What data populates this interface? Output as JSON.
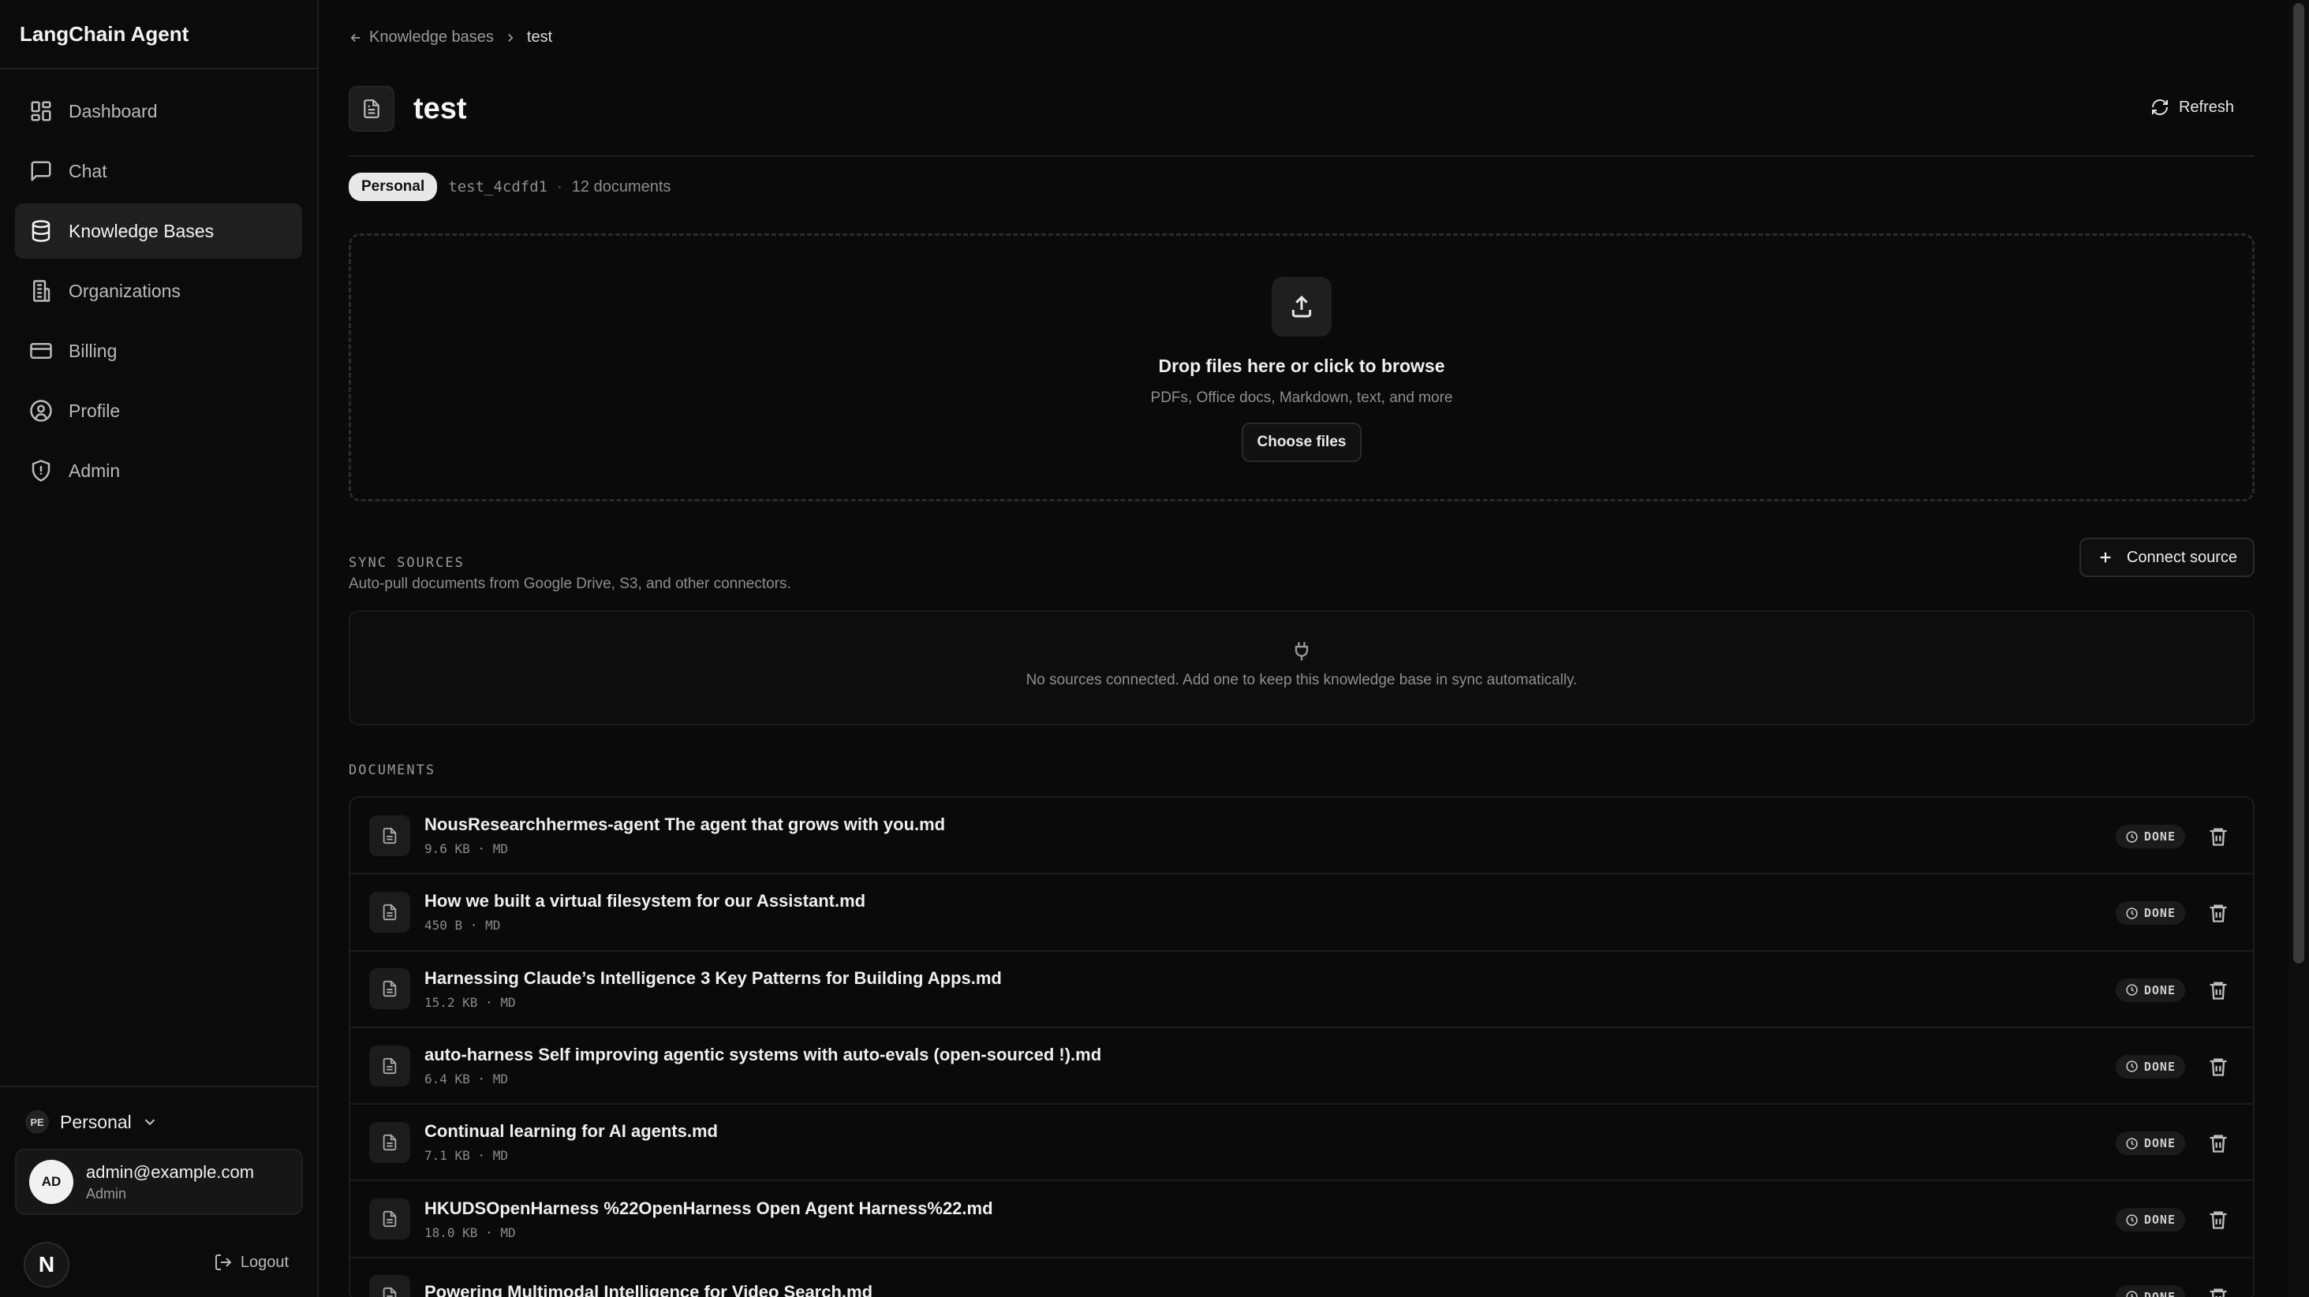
{
  "app": {
    "title": "LangChain Agent"
  },
  "sidebar": {
    "items": [
      {
        "label": "Dashboard",
        "icon": "dashboard-icon"
      },
      {
        "label": "Chat",
        "icon": "chat-icon"
      },
      {
        "label": "Knowledge Bases",
        "icon": "database-icon",
        "active": true
      },
      {
        "label": "Organizations",
        "icon": "building-icon"
      },
      {
        "label": "Billing",
        "icon": "credit-card-icon"
      },
      {
        "label": "Profile",
        "icon": "user-circle-icon"
      },
      {
        "label": "Admin",
        "icon": "shield-icon"
      }
    ],
    "workspace": {
      "badge": "PE",
      "name": "Personal"
    },
    "user": {
      "initials": "AD",
      "email": "admin@example.com",
      "role": "Admin"
    },
    "logo_letter": "N",
    "logout_label": "Logout"
  },
  "breadcrumb": {
    "parent": "Knowledge bases",
    "current": "test"
  },
  "header": {
    "title": "test",
    "refresh_label": "Refresh"
  },
  "meta": {
    "scope": "Personal",
    "kb_id": "test_4cdfd1",
    "dot": "·",
    "doc_count": "12 documents"
  },
  "dropzone": {
    "title": "Drop files here or click to browse",
    "subtitle": "PDFs, Office docs, Markdown, text, and more",
    "button": "Choose files"
  },
  "sync": {
    "label": "SYNC SOURCES",
    "description": "Auto-pull documents from Google Drive, S3, and other connectors.",
    "connect_label": "Connect source",
    "empty": "No sources connected. Add one to keep this knowledge base in sync automatically."
  },
  "documents": {
    "label": "DOCUMENTS",
    "items": [
      {
        "name": "NousResearchhermes-agent The agent that grows with you.md",
        "meta": "9.6 KB · MD",
        "status": "DONE"
      },
      {
        "name": "How we built a virtual filesystem for our Assistant.md",
        "meta": "450 B · MD",
        "status": "DONE"
      },
      {
        "name": "Harnessing Claude’s Intelligence 3 Key Patterns for Building Apps.md",
        "meta": "15.2 KB · MD",
        "status": "DONE"
      },
      {
        "name": "auto-harness Self improving agentic systems with auto-evals (open-sourced !).md",
        "meta": "6.4 KB · MD",
        "status": "DONE"
      },
      {
        "name": "Continual learning for AI agents.md",
        "meta": "7.1 KB · MD",
        "status": "DONE"
      },
      {
        "name": "HKUDSOpenHarness %22OpenHarness Open Agent Harness%22.md",
        "meta": "18.0 KB · MD",
        "status": "DONE"
      },
      {
        "name": "Powering Multimodal Intelligence for Video Search.md",
        "meta": "",
        "status": "DONE"
      }
    ]
  }
}
